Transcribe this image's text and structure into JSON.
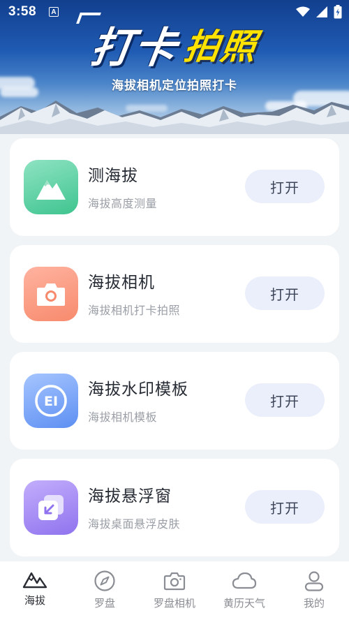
{
  "status_bar": {
    "time": "3:58",
    "a_badge": "A"
  },
  "banner": {
    "title_part1": "打卡",
    "title_part2": "拍照",
    "subtitle": "海拔相机定位拍照打卡"
  },
  "cards": [
    {
      "title": "测海拔",
      "subtitle": "海拔高度测量",
      "button": "打开",
      "icon": "mountain-icon",
      "color_from": "#8ee3c2",
      "color_to": "#3fc48f"
    },
    {
      "title": "海拔相机",
      "subtitle": "海拔相机打卡拍照",
      "button": "打开",
      "icon": "camera-icon",
      "color_from": "#ffb3a0",
      "color_to": "#f78a6d"
    },
    {
      "title": "海拔水印模板",
      "subtitle": "海拔相机模板",
      "button": "打开",
      "icon": "stamp-icon",
      "stamp_text": "EI",
      "color_from": "#a6c5ff",
      "color_to": "#5d8ff2"
    },
    {
      "title": "海拔悬浮窗",
      "subtitle": "海拔桌面悬浮皮肤",
      "button": "打开",
      "icon": "floating-window-icon",
      "color_from": "#c2aefc",
      "color_to": "#8f73ee"
    }
  ],
  "bottom_nav": [
    {
      "label": "海拔",
      "icon": "mountain-outline-icon",
      "active": true
    },
    {
      "label": "罗盘",
      "icon": "compass-icon",
      "active": false
    },
    {
      "label": "罗盘相机",
      "icon": "camera-outline-icon",
      "active": false
    },
    {
      "label": "黄历天气",
      "icon": "cloud-icon",
      "active": false
    },
    {
      "label": "我的",
      "icon": "user-icon",
      "active": false
    }
  ]
}
